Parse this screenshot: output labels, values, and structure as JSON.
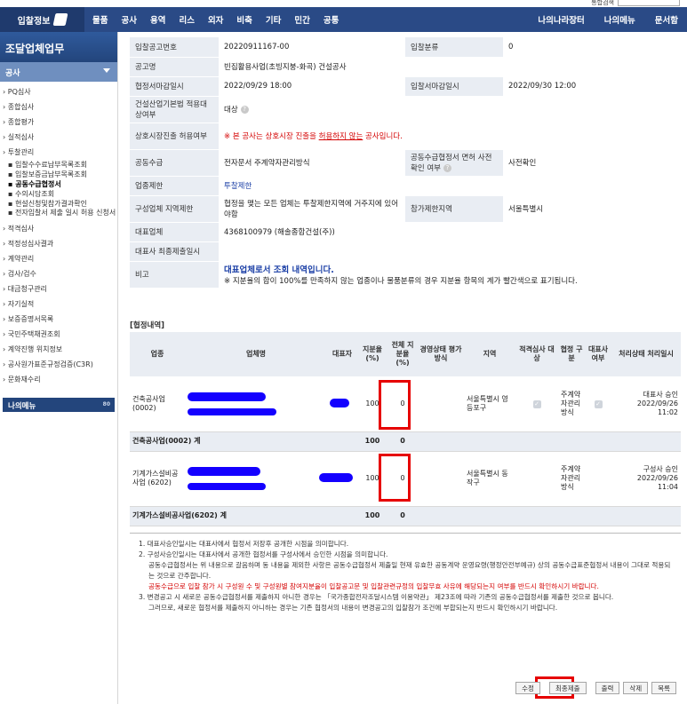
{
  "topstrip": {
    "search_label": "통합검색"
  },
  "nav": {
    "logo": "입찰정보",
    "menu": [
      "물품",
      "공사",
      "용역",
      "리스",
      "외자",
      "비축",
      "기타",
      "민간",
      "공통"
    ],
    "right": [
      "나의나라장터",
      "나의메뉴",
      "문서함"
    ]
  },
  "sidebar": {
    "title": "조달업체업무",
    "subtitle": "공사",
    "items_top": [
      "PQ심사",
      "종합심사",
      "종합평가",
      "실적심사",
      "투찰관리"
    ],
    "items_sub": [
      "입찰수수료납부목록조회",
      "입찰보증금납부목록조회",
      "공동수급협정서",
      "수의시담조회",
      "현설신청및참가결과확인",
      "전자입찰서 제출 일시 허용 신청서"
    ],
    "items_bottom": [
      "적격심사",
      "적정성심사결과",
      "계약관리",
      "검사/검수",
      "대금청구관리",
      "자기실적",
      "보증증명서목록",
      "국민주택채권조회",
      "계약진행 위치정보",
      "공사원가표준규정검증(C3R)",
      "문화재수리"
    ],
    "mymenu": "나의메뉴",
    "mymenu_tag": "80"
  },
  "info": {
    "bid_no_label": "입찰공고번호",
    "bid_no": "20220911167-00",
    "bid_class_label": "입찰분류",
    "bid_class": "0",
    "title_label": "공고명",
    "title": "빈집활용사업(초빙지붕-화곡) 건설공사",
    "deadline_label": "협정서마감일시",
    "deadline": "2022/09/29 18:00",
    "bid_deadline_label": "입찰서마감일시",
    "bid_deadline": "2022/09/30 12:00",
    "law_label": "건설산업기본법 적용대상여부",
    "law_value": "대상",
    "mutual_label": "상호시장진출 허용여부",
    "mutual_pre": "※ 본 공사는 상호시장 진출을 ",
    "mutual_link": "허용하지 않는",
    "mutual_post": " 공사입니다.",
    "joint_label": "공동수급",
    "joint_value": "전자문서 주계약자관리방식",
    "confirm_label": "공동수급협정서 면허 사전확인 여부",
    "confirm_value": "사전확인",
    "industry_label": "업종제한",
    "industry_value": "투찰제한",
    "region_label": "구성업체 지역제한",
    "region_value": "협정을 맺는 모든 업체는 투찰제한지역에 거주지에 있어야함",
    "part_region_label": "참가제한지역",
    "part_region_value": "서울특별시",
    "rep_label": "대표업체",
    "rep_value": "4368100979 (해솔종합건설(주))",
    "final_label": "대표사 최종제출일시",
    "final_value": "",
    "note_label": "비고",
    "note_bold": "대표업체로서 조회 내역입니다.",
    "note_text": "※ 지분율의 합이 100%를 만족하지 않는 업종이나 물품분류의 경우 지분율 항목의 계가 빨간색으로 표기됩니다."
  },
  "agreement": {
    "section_title": "[협정내역]",
    "headers": [
      "업종",
      "업체명",
      "대표자",
      "지분율 (%)",
      "전체 지분율 (%)",
      "경영상태 평가방식",
      "지역",
      "적격심사 대상",
      "협정 구분",
      "대표사 여부",
      "처리상태 처리일시"
    ],
    "rows": [
      {
        "industry": "건축공사업 (0002)",
        "share": "100",
        "total": "0",
        "region": "서울특별시 영등포구",
        "type": "주계약자관리방식",
        "status": "대표사 승인",
        "date": "2022/09/26",
        "time": "11:02"
      },
      {
        "industry": "기계가스설비공사업 (6202)",
        "share": "100",
        "total": "0",
        "region": "서울특별시 동작구",
        "type": "주계약자관리방식",
        "status": "구성사 승인",
        "date": "2022/09/26",
        "time": "11:04"
      }
    ],
    "sums": [
      {
        "label": "건축공사업(0002) 계",
        "share": "100",
        "total": "0"
      },
      {
        "label": "기계가스설비공사업(6202) 계",
        "share": "100",
        "total": "0"
      }
    ]
  },
  "notes": {
    "n1": "1. 대표사승인일시는 대표사에서 협정서 저장후 공개한 시점을 의미합니다.",
    "n2": "2. 구성사승인일시는 대표사에서 공개한 협정서를 구성사에서 승인한 시점을 의미합니다.",
    "n2a": "공동수급협정서는 위 내용으로 갈음하며 동 내용을 제외한 사항은 공동수급협정서 제출일 현재 유효한 공동계약 운영요령(행정안전부예규) 상의 공동수급표준협정서 내용이 그대로 적용되는 것으로 간주합니다.",
    "n2b": "공동수급으로 입찰 참가 시 구성원 수 및 구성원별 참여지분율이 입찰공고문 및 입찰관련규정의 입찰무효 사유에 해당되는지 여부를 반드시 확인하시기 바랍니다.",
    "n3": "3. 변경공고 시 새로운 공동수급협정서를 제출하지 아니한 경우는 「국가종합전자조달시스템 이용약관」 제23조에 따라 기존의 공동수급협정서를 제출한 것으로 봅니다.",
    "n3a": "그러므로, 새로운 협정서를 제출하지 아니하는 경우는 기존 협정서의 내용이 변경공고의 입찰참가 조건에 부합되는지 반드시 확인하시기 바랍니다."
  },
  "buttons": {
    "edit": "수정",
    "final": "최종제출",
    "print": "출력",
    "delete": "삭제",
    "list": "목록"
  },
  "colors": {
    "nav": "#2a4a86",
    "label_bg": "#e9edf3",
    "highlight": "#e60000",
    "redact": "#1400ff"
  }
}
